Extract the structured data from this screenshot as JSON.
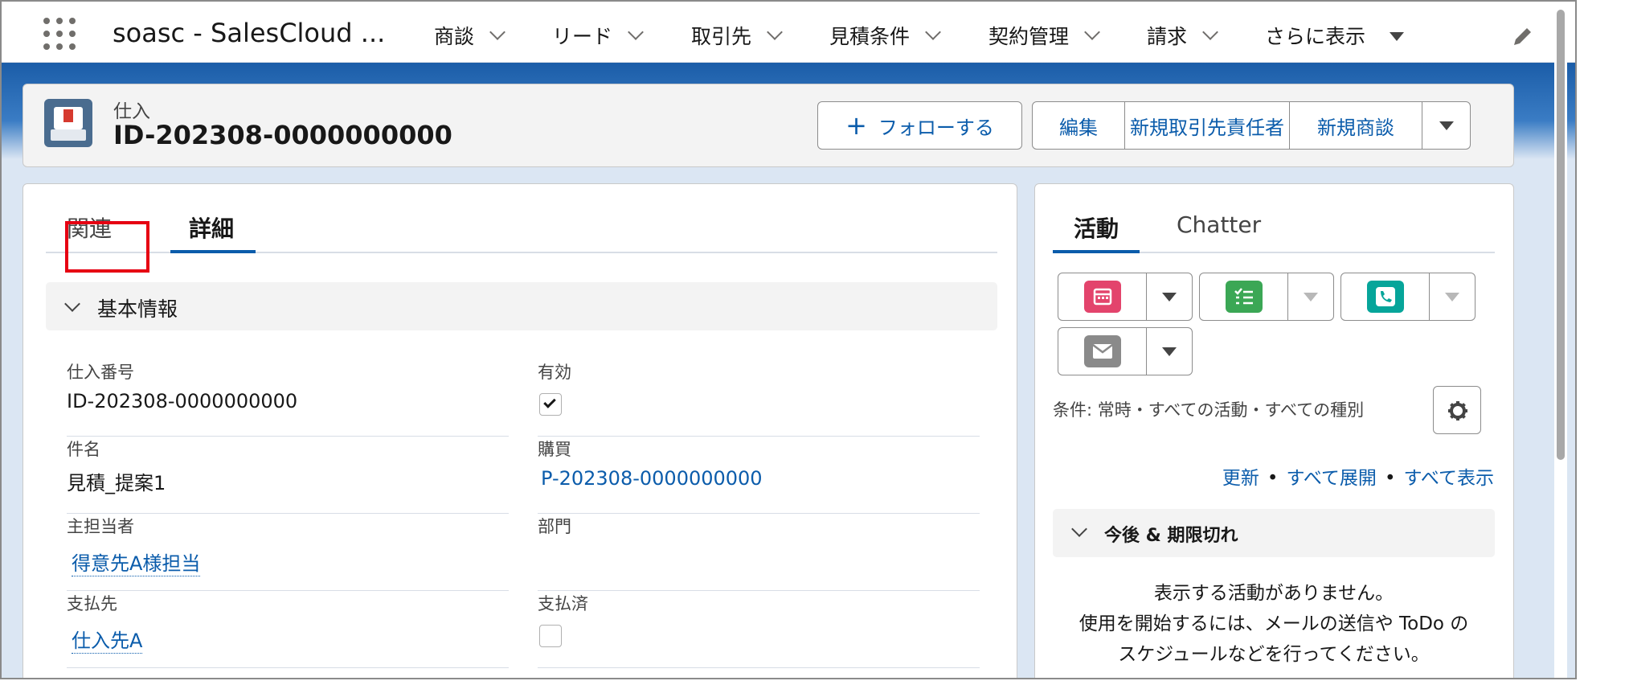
{
  "app": {
    "name": "soasc - SalesCloud ..."
  },
  "nav": [
    {
      "label": "商談",
      "caret": "chevron"
    },
    {
      "label": "リード",
      "caret": "chevron"
    },
    {
      "label": "取引先",
      "caret": "chevron"
    },
    {
      "label": "見積条件",
      "caret": "chevron"
    },
    {
      "label": "契約管理",
      "caret": "chevron"
    },
    {
      "label": "請求",
      "caret": "chevron"
    },
    {
      "label": "さらに表示",
      "caret": "triangle"
    }
  ],
  "record": {
    "object_label": "仕入",
    "title": "ID-202308-0000000000",
    "icon": "purchase-basket-icon"
  },
  "actions": {
    "follow": "フォローする",
    "edit": "編集",
    "new_contact": "新規取引先責任者",
    "new_opportunity": "新規商談"
  },
  "tabs": {
    "related": "関連",
    "details": "詳細"
  },
  "section": {
    "title": "基本情報"
  },
  "fields": {
    "purchase_no": {
      "label": "仕入番号",
      "value": "ID-202308-0000000000"
    },
    "active": {
      "label": "有効",
      "checked": true
    },
    "subject": {
      "label": "件名",
      "value": "見積_提案1"
    },
    "purchase": {
      "label": "購買",
      "value": "P-202308-0000000000"
    },
    "owner": {
      "label": "主担当者",
      "value": "得意先A様担当"
    },
    "department": {
      "label": "部門",
      "value": ""
    },
    "payee": {
      "label": "支払先",
      "value": "仕入先A"
    },
    "paid": {
      "label": "支払済",
      "checked": false
    }
  },
  "side": {
    "tabs": {
      "activity": "活動",
      "chatter": "Chatter"
    },
    "activity_buttons": [
      {
        "icon": "calendar-icon",
        "color": "#e3446c"
      },
      {
        "icon": "task-icon",
        "color": "#3ba755"
      },
      {
        "icon": "phone-icon",
        "color": "#06a59a"
      },
      {
        "icon": "email-icon",
        "color": "#8a8a8a"
      }
    ],
    "filter_text": "条件: 常時・すべての活動・すべての種別",
    "links": {
      "refresh": "更新",
      "expand_all": "すべて展開",
      "show_all": "すべて表示"
    },
    "upcoming_title": "今後 & 期限切れ",
    "empty_line1": "表示する活動がありません。",
    "empty_line2": "使用を開始するには、メールの送信や ToDo の",
    "empty_line3": "スケジュールなどを行ってください。"
  },
  "colors": {
    "brand": "#0b5cab",
    "highlight": "#e60012"
  }
}
